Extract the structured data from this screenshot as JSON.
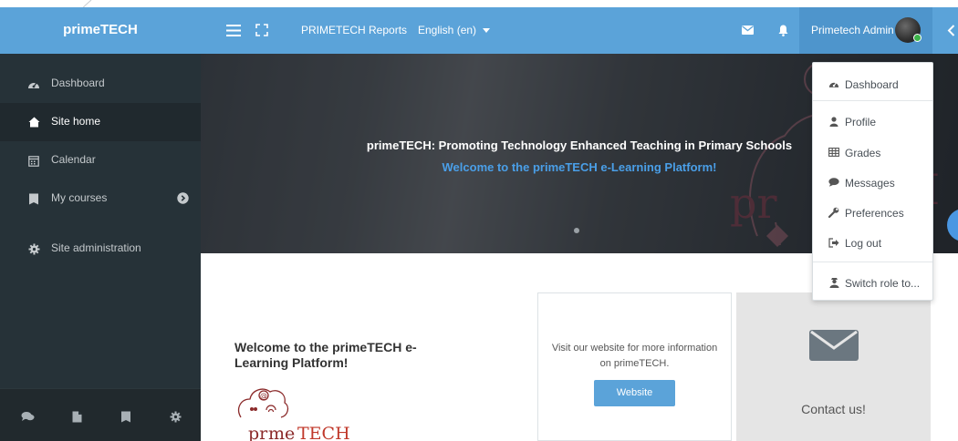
{
  "navbar": {
    "brand": "primeTECH",
    "reports_link": "PRIMETECH Reports",
    "language": "English (en)",
    "icons": [
      "hamburger-icon",
      "fullscreen-icon",
      "mail-icon",
      "bell-icon",
      "chevron-left-icon"
    ],
    "user_name": "Primetech Admin"
  },
  "sidebar": {
    "items": [
      {
        "label": "Dashboard",
        "icon": "dashboard-icon",
        "active": false
      },
      {
        "label": "Site home",
        "icon": "home-icon",
        "active": true
      },
      {
        "label": "Calendar",
        "icon": "calendar-icon",
        "active": false
      },
      {
        "label": "My courses",
        "icon": "courses-icon",
        "active": false
      },
      {
        "label": "Site administration",
        "icon": "gear-icon",
        "active": false
      }
    ],
    "bottom_icons": [
      "comments-icon",
      "file-icon",
      "book-icon",
      "gear-icon"
    ]
  },
  "hero": {
    "title": "primeTECH: Promoting Technology Enhanced Teaching in Primary Schools",
    "subtitle": "Welcome to the primeTECH e-Learning Platform!"
  },
  "user_menu": {
    "items": [
      {
        "label": "Dashboard",
        "icon": "dashboard-icon"
      },
      {
        "label": "Profile",
        "icon": "user-icon"
      },
      {
        "label": "Grades",
        "icon": "table-icon"
      },
      {
        "label": "Messages",
        "icon": "chat-icon"
      },
      {
        "label": "Preferences",
        "icon": "wrench-icon"
      },
      {
        "label": "Log out",
        "icon": "sign-out-icon"
      }
    ],
    "switch_role": {
      "label": "Switch role to...",
      "icon": "user-secret-icon"
    }
  },
  "content": {
    "welcome_title": "Welcome to the primeTECH e-Learning Platform!",
    "website_card": {
      "text": "Visit our website for more information on primeTECH.",
      "button": "Website"
    },
    "contact_card": {
      "text": "Contact us!"
    }
  },
  "colors": {
    "navbar": "#5ba3d9",
    "sidebar": "#263238",
    "accent_blue": "#4a9fe8",
    "logo_maroon": "#8b2a2a"
  }
}
